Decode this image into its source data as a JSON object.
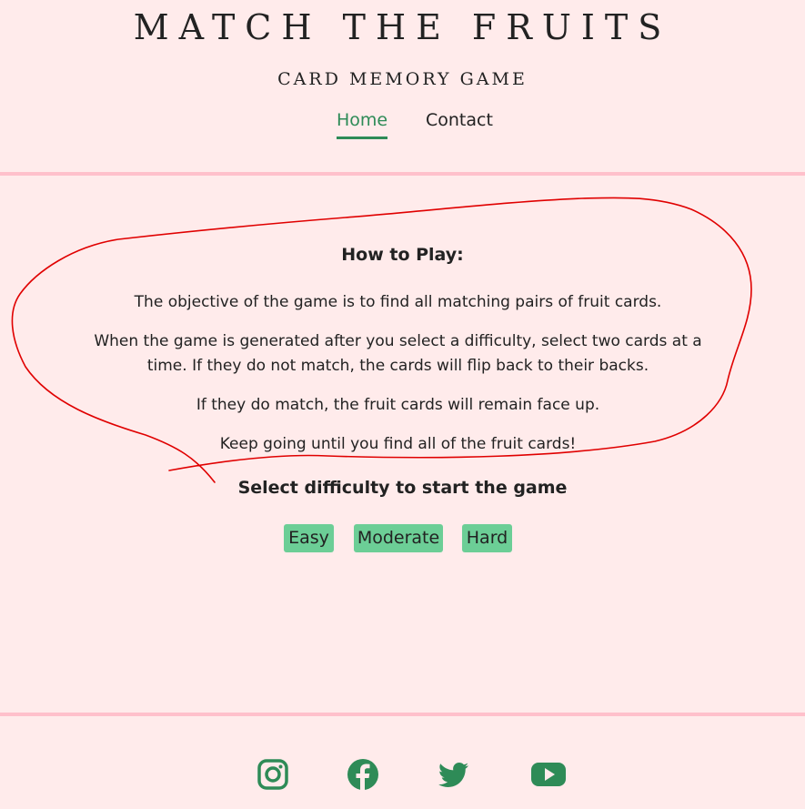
{
  "header": {
    "title": "MATCH THE FRUITS",
    "subtitle": "CARD MEMORY GAME",
    "nav": {
      "home": "Home",
      "contact": "Contact"
    }
  },
  "main": {
    "howto_title": "How to Play:",
    "paragraphs": [
      "The objective of the game is to find all matching pairs of fruit cards.",
      "When the game is generated after you select a difficulty, select two cards at a time. If they do not match, the cards will flip back to their backs.",
      "If they do match, the fruit cards will remain face up.",
      "Keep going until you find all of the fruit cards!"
    ],
    "difficulty_title": "Select difficulty to start the game",
    "buttons": {
      "easy": "Easy",
      "moderate": "Moderate",
      "hard": "Hard"
    }
  },
  "footer": {
    "social_icons": [
      "instagram-icon",
      "facebook-icon",
      "twitter-icon",
      "youtube-icon"
    ]
  },
  "colors": {
    "background": "#ffebeb",
    "divider": "#ffc0cb",
    "accent": "#2e8b57",
    "button": "#6cce96",
    "annotation": "#e00000"
  }
}
